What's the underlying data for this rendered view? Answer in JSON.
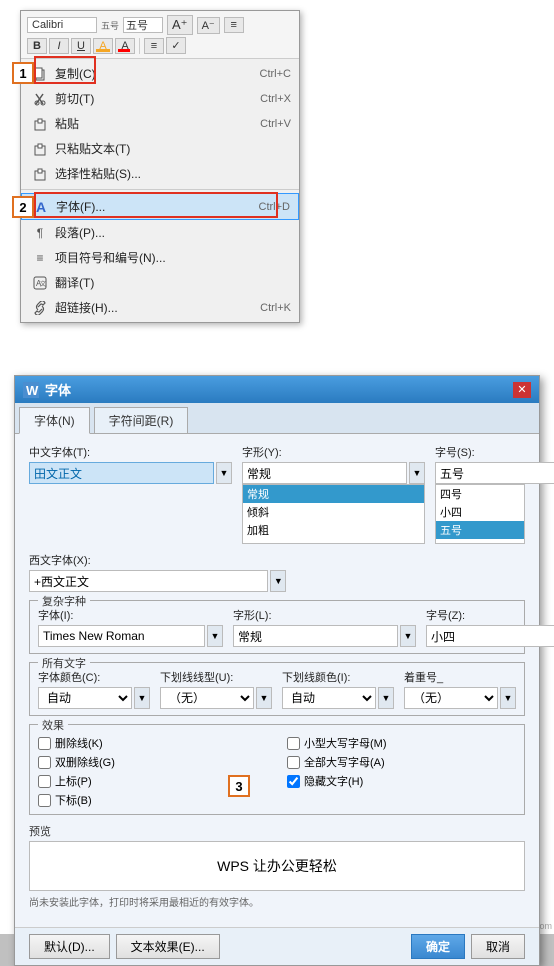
{
  "app": {
    "title": "字体"
  },
  "contextMenu": {
    "miniToolbar": {
      "fontName": "Calibri",
      "fontSize": "五号",
      "buttons": [
        "B",
        "I",
        "U",
        "A",
        "≡",
        "✓"
      ]
    },
    "items": [
      {
        "id": "copy",
        "icon": "📋",
        "label": "复制(C)",
        "shortcut": "Ctrl+C"
      },
      {
        "id": "cut",
        "icon": "✂",
        "label": "剪切(T)",
        "shortcut": "Ctrl+X"
      },
      {
        "id": "paste",
        "icon": "📄",
        "label": "粘贴",
        "shortcut": "Ctrl+V"
      },
      {
        "id": "paste-text",
        "icon": "📄",
        "label": "只粘贴文本(T)",
        "shortcut": ""
      },
      {
        "id": "paste-special",
        "icon": "📄",
        "label": "选择性粘贴(S)...",
        "shortcut": ""
      },
      {
        "id": "font",
        "icon": "A",
        "label": "字体(F)...",
        "shortcut": "Ctrl+D",
        "highlighted": true
      },
      {
        "id": "paragraph",
        "icon": "¶",
        "label": "段落(P)...",
        "shortcut": ""
      },
      {
        "id": "bullets",
        "icon": "≡",
        "label": "项目符号和编号(N)...",
        "shortcut": ""
      },
      {
        "id": "translate",
        "icon": "🌐",
        "label": "翻译(T)",
        "shortcut": ""
      },
      {
        "id": "hyperlink",
        "icon": "🔗",
        "label": "超链接(H)...",
        "shortcut": "Ctrl+K"
      }
    ]
  },
  "fontDialog": {
    "tabs": [
      {
        "id": "font",
        "label": "字体(N)",
        "active": true
      },
      {
        "id": "spacing",
        "label": "字符间距(R)"
      }
    ],
    "chineseFontLabel": "中文字体(T):",
    "chinesFontValue": "田文正文",
    "westernFontLabel": "西文字体(X):",
    "westernFontValue": "+西文正文",
    "styleLabel": "字形(Y):",
    "styleValue": "常规",
    "styleOptions": [
      "常规",
      "倾斜",
      "加粗"
    ],
    "sizeLabel": "字号(S):",
    "sizeValue": "五号",
    "sizeOptions": [
      "四号",
      "小四",
      "五号"
    ],
    "complexFontSection": "复杂字种",
    "complexFontLabel": "字体(I):",
    "complexFontValue": "Times New Roman",
    "complexStyleLabel": "字形(L):",
    "complexStyleValue": "常规",
    "complexSizeLabel": "字号(Z):",
    "complexSizeValue": "小四",
    "allCharsSection": "所有文字",
    "fontColorLabel": "字体颜色(C):",
    "fontColorValue": "自动",
    "underlineTypeLabel": "下划线线型(U):",
    "underlineTypeValue": "（无）",
    "underlineColorLabel": "下划线颜色(I):",
    "underlineColorValue": "自动",
    "emphasisLabel": "着重号_",
    "emphasisValue": "（无）",
    "effectsSection": "效果",
    "effects": [
      {
        "id": "strikethrough",
        "label": "删除线(K)",
        "checked": false
      },
      {
        "id": "small-caps",
        "label": "小型大写字母(M)",
        "checked": false
      },
      {
        "id": "double-strike",
        "label": "双删除线(G)",
        "checked": false
      },
      {
        "id": "all-caps",
        "label": "全部大写字母(A)",
        "checked": false
      },
      {
        "id": "superscript",
        "label": "上标(P)",
        "checked": false
      },
      {
        "id": "hidden",
        "label": "隐藏文字(H)",
        "checked": true
      },
      {
        "id": "subscript",
        "label": "下标(B)",
        "checked": false
      }
    ],
    "previewSection": "预览",
    "previewText": "WPS 让办公更轻松",
    "previewNote": "尚未安装此字体，打印时将采用最相近的有效字体。",
    "defaultBtn": "默认(D)...",
    "textEffectsBtn": "文本效果(E)...",
    "okBtn": "确定",
    "cancelBtn": "取消"
  },
  "steps": {
    "step1": "1",
    "step2": "2",
    "step3": "3"
  },
  "watermark": "图 itrain.com"
}
